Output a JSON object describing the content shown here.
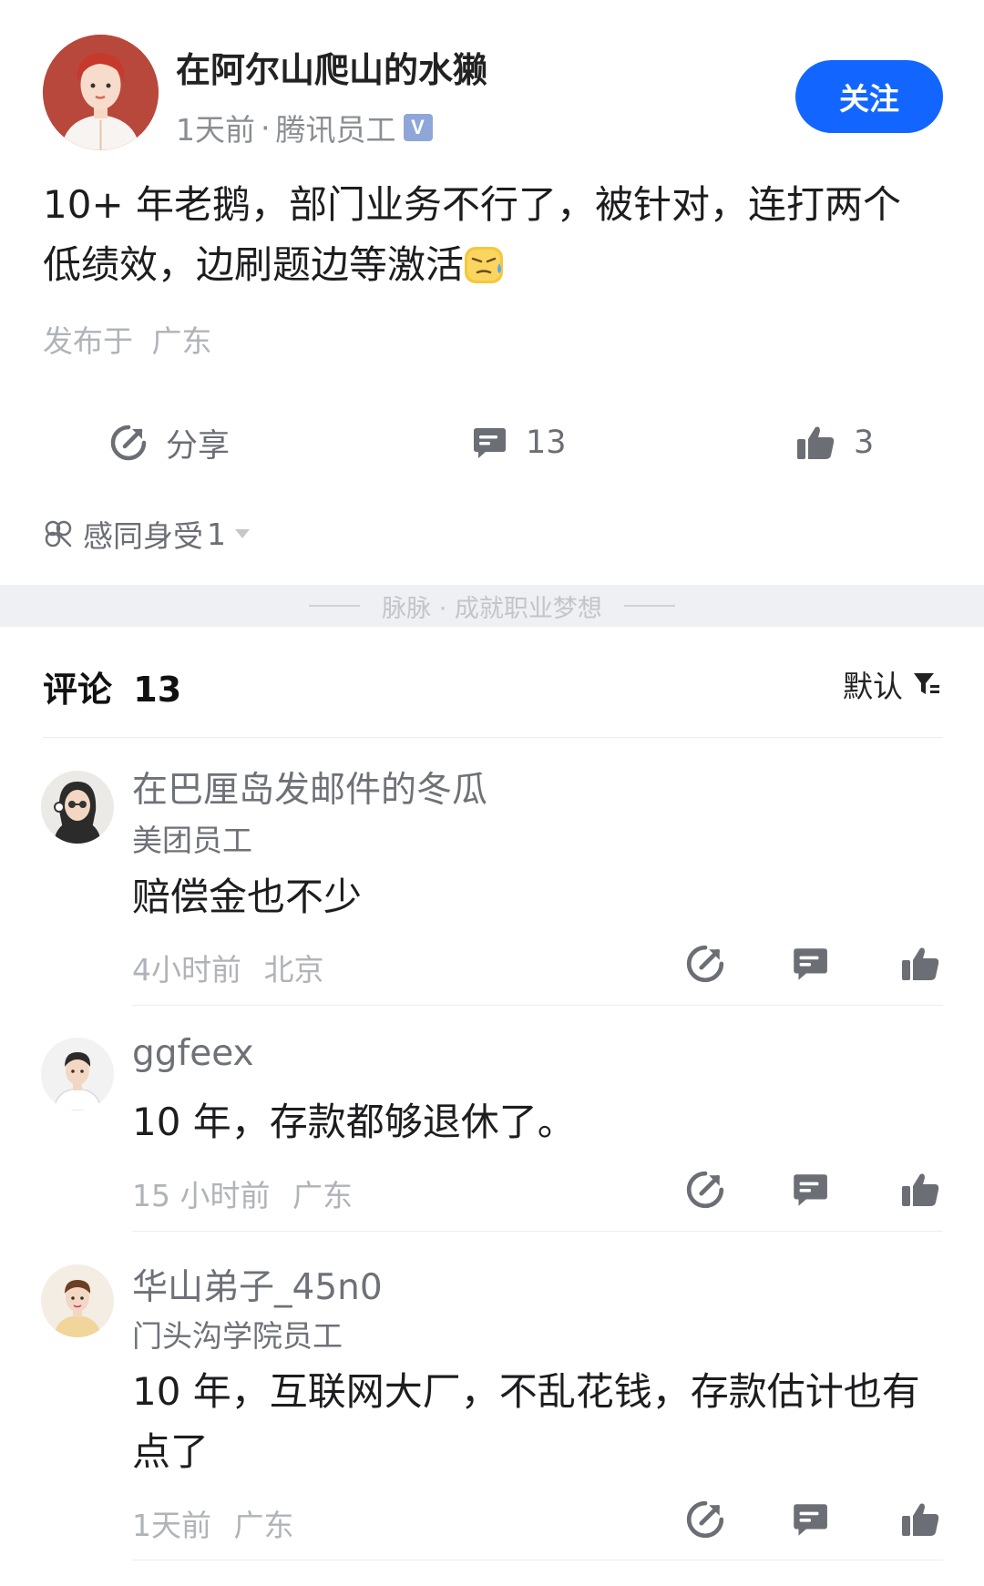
{
  "post": {
    "author_name": "在阿尔山爬山的水獭",
    "time": "1天前",
    "separator": "·",
    "company": "腾讯员工",
    "verified_mark": "V",
    "follow_label": "关注",
    "body_text": "10+ 年老鹅，部门业务不行了，被针对，连打两个低绩效，边刷题边等激活",
    "location_label": "发布于",
    "location": "广东"
  },
  "actions": {
    "share_label": "分享",
    "comment_count": "13",
    "like_count": "3"
  },
  "reaction": {
    "label": "感同身受",
    "count": "1"
  },
  "divider": {
    "text": "脉脉 · 成就职业梦想"
  },
  "comments_header": {
    "title": "评论",
    "count": "13",
    "sort_label": "默认"
  },
  "comments": [
    {
      "name": "在巴厘岛发邮件的冬瓜",
      "company": "美团员工",
      "text": "赔偿金也不少",
      "time": "4小时前",
      "location": "北京"
    },
    {
      "name": "ggfeex",
      "company": "",
      "text": "10 年，存款都够退休了。",
      "time": "15 小时前",
      "location": "广东"
    },
    {
      "name": "华山弟子_45n0",
      "company": "门头沟学院员工",
      "text": "10 年，互联网大厂，不乱花钱，存款估计也有点了",
      "time": "1天前",
      "location": "广东"
    }
  ],
  "colors": {
    "accent": "#1266ff",
    "icon_gray": "#6b6e74",
    "muted_text": "#b0b3b8",
    "divider_band": "#eef0f3"
  },
  "icons": {
    "share": "share-icon",
    "comment": "comment-icon",
    "like": "thumbs-up-icon",
    "reaction": "clover-icon",
    "sort": "filter-icon",
    "dropdown": "triangle-down-icon"
  }
}
